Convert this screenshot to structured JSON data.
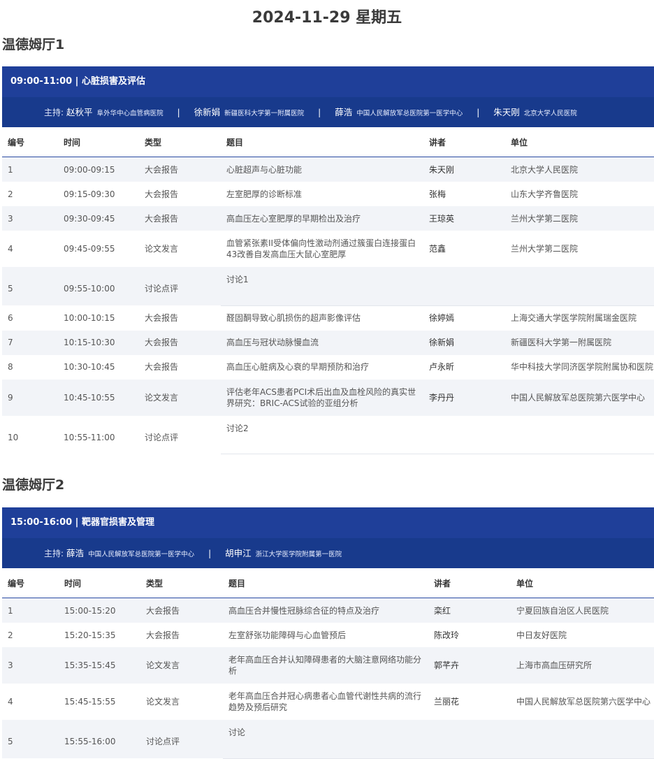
{
  "date_title": "2024-11-29 星期五",
  "headers": {
    "no": "编号",
    "time": "时间",
    "type": "类型",
    "topic": "题目",
    "speaker": "讲者",
    "unit": "单位"
  },
  "host_label": "主持:",
  "sep": "|",
  "halls": [
    {
      "name": "温德姆厅1",
      "session_title": "09:00-11:00 | 心脏损害及评估",
      "hosts": [
        {
          "name": "赵秋平",
          "unit": "阜外华中心血管病医院"
        },
        {
          "name": "徐新娟",
          "unit": "新疆医科大学第一附属医院"
        },
        {
          "name": "薛浩",
          "unit": "中国人民解放军总医院第一医学中心"
        },
        {
          "name": "朱天刚",
          "unit": "北京大学人民医院"
        }
      ],
      "rows": [
        {
          "no": "1",
          "time": "09:00-09:15",
          "type": "大会报告",
          "topic": "心脏超声与心脏功能",
          "speaker": "朱天刚",
          "unit": "北京大学人民医院"
        },
        {
          "no": "2",
          "time": "09:15-09:30",
          "type": "大会报告",
          "topic": "左室肥厚的诊断标准",
          "speaker": "张梅",
          "unit": "山东大学齐鲁医院"
        },
        {
          "no": "3",
          "time": "09:30-09:45",
          "type": "大会报告",
          "topic": "高血压左心室肥厚的早期检出及治疗",
          "speaker": "王琼英",
          "unit": "兰州大学第二医院"
        },
        {
          "no": "4",
          "time": "09:45-09:55",
          "type": "论文发言",
          "topic": "血管紧张素II受体偏向性激动剂通过簇蛋白连接蛋白43改善自发高血压大鼠心室肥厚",
          "speaker": "范鑫",
          "unit": "兰州大学第二医院"
        },
        {
          "no": "5",
          "time": "09:55-10:00",
          "type": "讨论点评",
          "topic": "讨论1",
          "speaker": "",
          "unit": ""
        },
        {
          "no": "6",
          "time": "10:00-10:15",
          "type": "大会报告",
          "topic": "醛固酮导致心肌损伤的超声影像评估",
          "speaker": "徐婷嫣",
          "unit": "上海交通大学医学院附属瑞金医院"
        },
        {
          "no": "7",
          "time": "10:15-10:30",
          "type": "大会报告",
          "topic": "高血压与冠状动脉慢血流",
          "speaker": "徐新娟",
          "unit": "新疆医科大学第一附属医院"
        },
        {
          "no": "8",
          "time": "10:30-10:45",
          "type": "大会报告",
          "topic": "高血压心脏病及心衰的早期预防和治疗",
          "speaker": "卢永昕",
          "unit": "华中科技大学同济医学院附属协和医院"
        },
        {
          "no": "9",
          "time": "10:45-10:55",
          "type": "论文发言",
          "topic": "评估老年ACS患者PCI术后出血及血栓风险的真实世界研究：BRIC-ACS试验的亚组分析",
          "speaker": "李丹丹",
          "unit": "中国人民解放军总医院第六医学中心"
        },
        {
          "no": "10",
          "time": "10:55-11:00",
          "type": "讨论点评",
          "topic": "讨论2",
          "speaker": "",
          "unit": ""
        }
      ]
    },
    {
      "name": "温德姆厅2",
      "session_title": "15:00-16:00 | 靶器官损害及管理",
      "hosts": [
        {
          "name": "薛浩",
          "unit": "中国人民解放军总医院第一医学中心"
        },
        {
          "name": "胡申江",
          "unit": "浙江大学医学院附属第一医院"
        }
      ],
      "rows": [
        {
          "no": "1",
          "time": "15:00-15:20",
          "type": "大会报告",
          "topic": "高血压合并慢性冠脉综合征的特点及治疗",
          "speaker": "栾红",
          "unit": "宁夏回族自治区人民医院"
        },
        {
          "no": "2",
          "time": "15:20-15:35",
          "type": "大会报告",
          "topic": "左室舒张功能障碍与心血管预后",
          "speaker": "陈改玲",
          "unit": "中日友好医院"
        },
        {
          "no": "3",
          "time": "15:35-15:45",
          "type": "论文发言",
          "topic": "老年高血压合并认知障碍患者的大脑注意网络功能分析",
          "speaker": "郭芊卉",
          "unit": "上海市高血压研究所"
        },
        {
          "no": "4",
          "time": "15:45-15:55",
          "type": "论文发言",
          "topic": "老年高血压合并冠心病患者心血管代谢性共病的流行趋势及预后研究",
          "speaker": "兰丽花",
          "unit": "中国人民解放军总医院第六医学中心"
        },
        {
          "no": "5",
          "time": "15:55-16:00",
          "type": "讨论点评",
          "topic": "讨论",
          "speaker": "",
          "unit": ""
        }
      ]
    }
  ]
}
